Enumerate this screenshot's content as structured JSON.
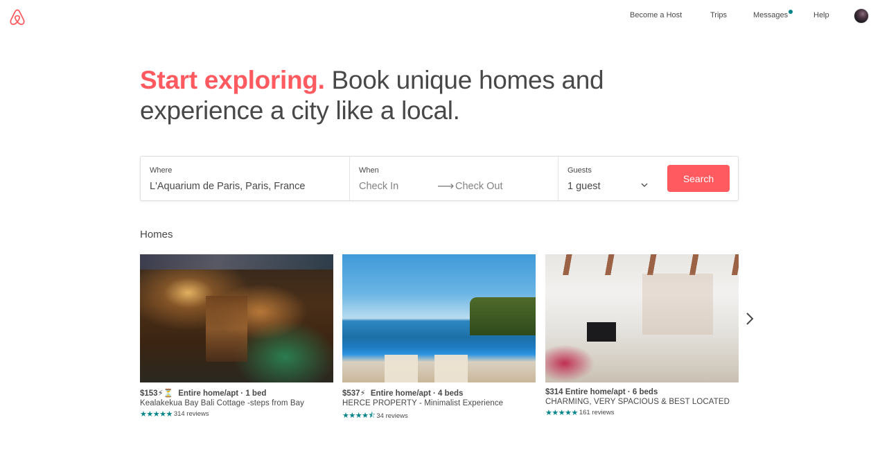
{
  "header": {
    "logo": "airbnb-logo",
    "nav": {
      "become_host": "Become a Host",
      "trips": "Trips",
      "messages": "Messages",
      "help": "Help"
    },
    "messages_unread": true
  },
  "hero": {
    "accent": "Start exploring.",
    "rest": " Book unique homes and experience a city like a local."
  },
  "search": {
    "where_label": "Where",
    "where_value": "L'Aquarium de Paris, Paris, France",
    "when_label": "When",
    "check_in_placeholder": "Check In",
    "check_out_placeholder": "Check Out",
    "guests_label": "Guests",
    "guests_value": "1 guest",
    "search_button": "Search"
  },
  "homes": {
    "title": "Homes",
    "cards": [
      {
        "price": "$153",
        "badges": "⚡⏳",
        "type": "Entire home/apt · 1 bed",
        "name": "Kealakekua Bay Bali Cottage -steps from Bay",
        "rating": 5,
        "stars": "★★★★★",
        "reviews": "314 reviews"
      },
      {
        "price": "$537",
        "badges": "⚡",
        "type": "Entire home/apt · 4 beds",
        "name": "HERCE PROPERTY - Minimalist Experience",
        "rating": 4.5,
        "stars": "★★★★⯪",
        "reviews": "34 reviews"
      },
      {
        "price": "$314",
        "badges": "",
        "type": "Entire home/apt · 6 beds",
        "name": "CHARMING, VERY SPACIOUS & BEST LOCATED",
        "rating": 5,
        "stars": "★★★★★",
        "reviews": "161 reviews"
      }
    ]
  },
  "colors": {
    "brand": "#ff5a5f",
    "accent_teal": "#008489",
    "text": "#484848"
  }
}
